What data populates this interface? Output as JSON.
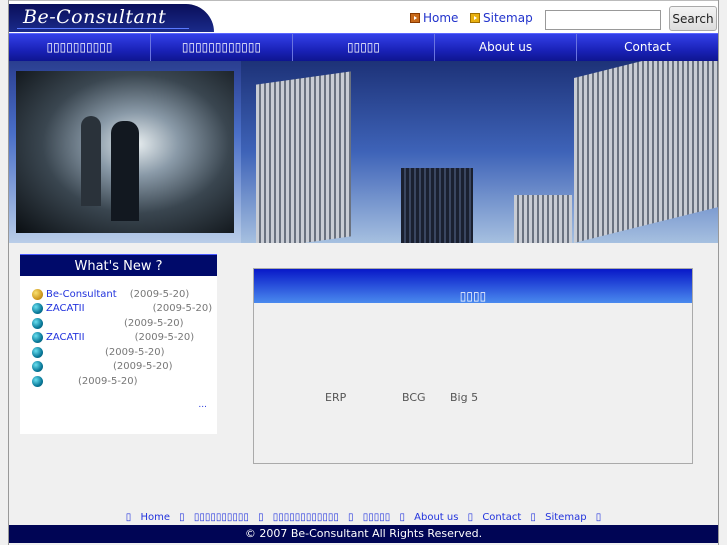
{
  "header": {
    "logo_text": "Be-Consultant",
    "home_link": "Home",
    "sitemap_link": "Sitemap",
    "search_placeholder": "",
    "search_button": "Search"
  },
  "nav": [
    "▯▯▯▯▯▯▯▯▯▯",
    "▯▯▯▯▯▯▯▯▯▯▯▯",
    "▯▯▯▯▯",
    "About us",
    "Contact"
  ],
  "whats_new": {
    "title": "What's New ?",
    "items": [
      {
        "icon": "gold-bullet-icon",
        "title": "Be-Consultant",
        "date": "(2009-5-20)"
      },
      {
        "icon": "teal-bullet-icon",
        "title": "ZACATII",
        "date": "(2009-5-20)"
      },
      {
        "icon": "teal-bullet-icon",
        "title": "",
        "date": "(2009-5-20)"
      },
      {
        "icon": "teal-bullet-icon",
        "title": "ZACATII",
        "date": "(2009-5-20)"
      },
      {
        "icon": "teal-bullet-icon",
        "title": "",
        "date": "(2009-5-20)"
      },
      {
        "icon": "teal-bullet-icon",
        "title": "",
        "date": "(2009-5-20)"
      },
      {
        "icon": "teal-bullet-icon",
        "title": "",
        "date": "(2009-5-20)"
      }
    ],
    "more": "..."
  },
  "panel": {
    "title": "▯▯▯▯",
    "terms": [
      "ERP",
      "BCG",
      "Big 5"
    ]
  },
  "footer": {
    "sep": "▯",
    "links": [
      "Home",
      "▯▯▯▯▯▯▯▯▯▯",
      "▯▯▯▯▯▯▯▯▯▯▯▯",
      "▯▯▯▯▯",
      "About us",
      "Contact",
      "Sitemap"
    ],
    "copyright": "© 2007 Be-Consultant All Rights Reserved."
  }
}
